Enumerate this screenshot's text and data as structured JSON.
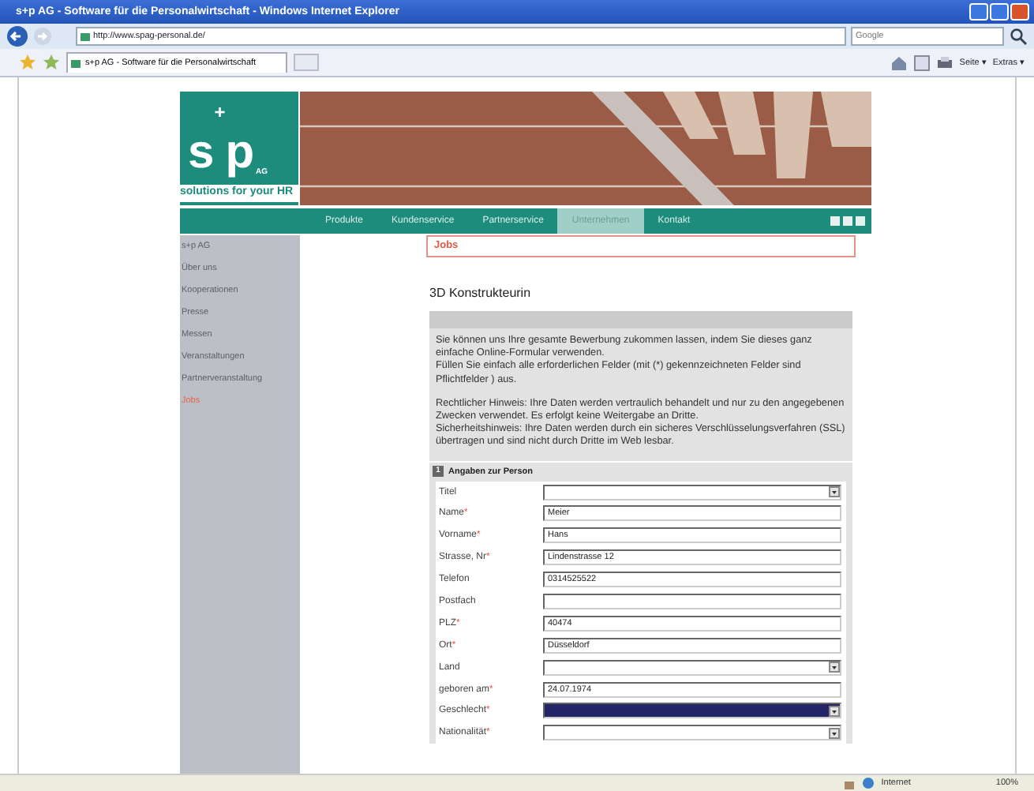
{
  "window": {
    "title": "s+p AG - Software für die Personalwirtschaft - Windows Internet Explorer"
  },
  "browser": {
    "address": "http://www.spag-personal.de/",
    "search_placeholder": "Google",
    "tab": "s+p AG - Software für die Personalwirtschaft",
    "tools": [
      "Seite ▾",
      "Extras ▾"
    ]
  },
  "logo": {
    "letter_1": "s",
    "plus": "+",
    "letter_2": "p",
    "suffix": "AG",
    "slogan": "solutions for your HR"
  },
  "nav": [
    {
      "label": "Produkte",
      "selected": false
    },
    {
      "label": "Kundenservice",
      "selected": false
    },
    {
      "label": "Partnerservice",
      "selected": false
    },
    {
      "label": "Unternehmen",
      "selected": true
    },
    {
      "label": "Kontakt",
      "selected": false
    }
  ],
  "sidebar": [
    {
      "label": "s+p AG",
      "selected": false
    },
    {
      "label": "Über uns",
      "selected": false
    },
    {
      "label": "Kooperationen",
      "selected": false
    },
    {
      "label": "Presse",
      "selected": false
    },
    {
      "label": "Messen",
      "selected": false
    },
    {
      "label": "Veranstaltungen",
      "selected": false
    },
    {
      "label": "Partnerveranstaltung",
      "selected": false
    },
    {
      "label": "Jobs",
      "selected": true
    }
  ],
  "breadcrumb": "Jobs",
  "heading": "3D Konstrukteurin",
  "intro": [
    [
      "Sie können uns Ihre gesamte Bewerbung zukommen lassen, indem Sie dieses ganz einfache Online-Formular verwenden.",
      "Füllen Sie einfach alle erforderlichen Felder (mit (*) gekennzeichneten Felder sind Pflichtfelder ) aus."
    ],
    [
      "Rechtlicher Hinweis: Ihre Daten werden vertraulich behandelt und nur zu den angegebenen Zwecken verwendet. Es erfolgt keine Weitergabe an Dritte.",
      "Sicherheitshinweis: Ihre Daten werden durch ein sicheres Verschlüsselungsverfahren (SSL) übertragen und sind nicht durch Dritte im Web lesbar."
    ]
  ],
  "section": {
    "number": "1",
    "title": "Angaben zur Person"
  },
  "fields": [
    {
      "label": "Titel",
      "required": false,
      "kind": "select",
      "highlighted": false
    },
    {
      "label": "Name",
      "required": true,
      "kind": "text",
      "value": "Meier",
      "highlighted": false
    },
    {
      "label": "Vorname",
      "required": true,
      "kind": "text",
      "value": "Hans",
      "highlighted": false
    },
    {
      "label": "Strasse, Nr",
      "required": true,
      "kind": "text",
      "value": "Lindenstrasse 12",
      "highlighted": false
    },
    {
      "label": "Telefon",
      "required": false,
      "kind": "text",
      "value": "0314525522",
      "highlighted": false
    },
    {
      "label": "Postfach",
      "required": false,
      "kind": "text",
      "highlighted": false
    },
    {
      "label": "PLZ",
      "required": true,
      "kind": "text",
      "value": "40474",
      "highlighted": false
    },
    {
      "label": "Ort",
      "required": true,
      "kind": "text",
      "value": "Düsseldorf",
      "highlighted": false
    },
    {
      "label": "Land",
      "required": false,
      "kind": "select",
      "highlighted": false
    },
    {
      "label": "geboren am",
      "required": true,
      "kind": "text",
      "value": "24.07.1974",
      "highlighted": false
    },
    {
      "label": "Geschlecht",
      "required": true,
      "kind": "select",
      "highlighted": true
    },
    {
      "label": "Nationalität",
      "required": true,
      "kind": "select",
      "highlighted": false
    }
  ],
  "required_mark": "*",
  "status_bar": {
    "zone": "Internet",
    "zoom": "100%"
  }
}
